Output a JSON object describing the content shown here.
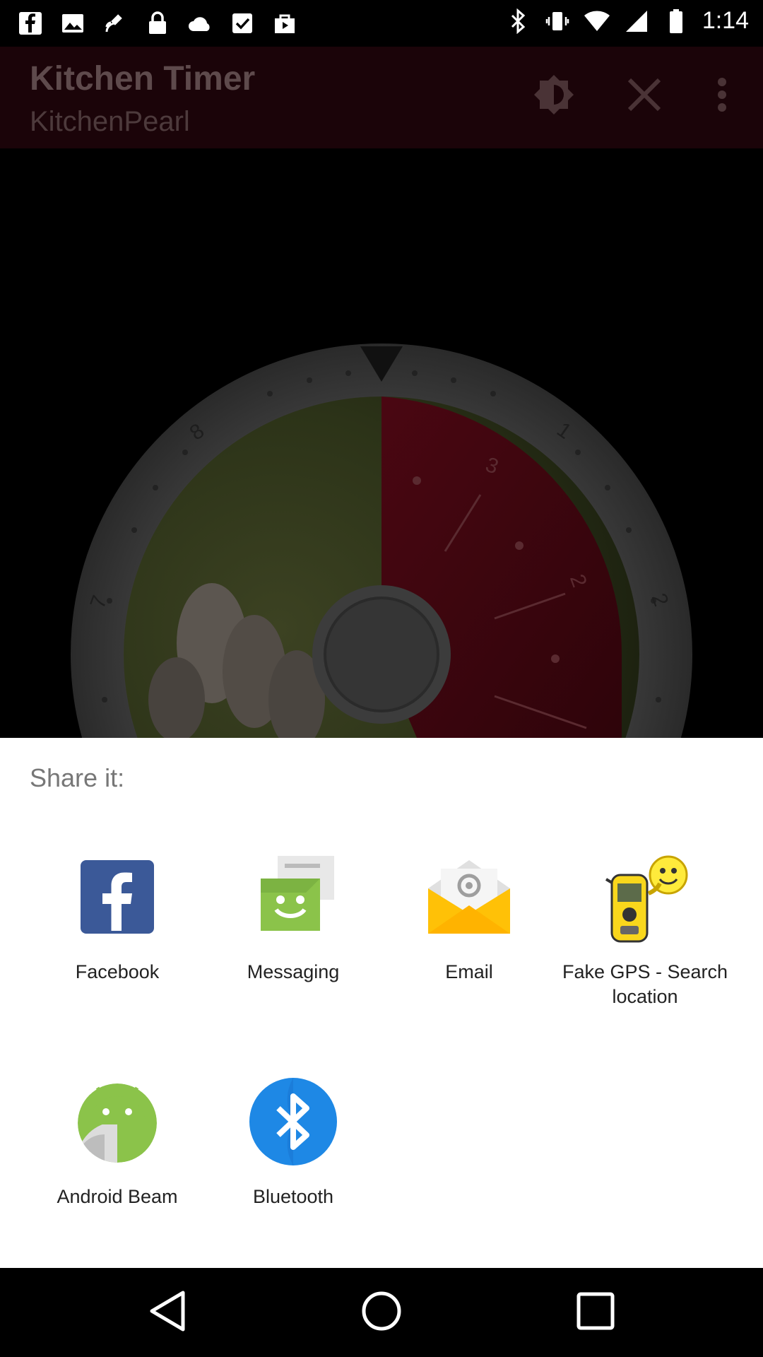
{
  "status_bar": {
    "time": "1:14",
    "left_icons": [
      "facebook-icon",
      "gallery-icon",
      "satellite-icon",
      "lock-icon",
      "cloud-icon",
      "check-box-icon",
      "shop-icon"
    ],
    "right_icons": [
      "bluetooth-icon",
      "vibrate-icon",
      "wifi-icon",
      "signal-icon",
      "battery-icon"
    ]
  },
  "app_header": {
    "title": "Kitchen Timer",
    "subtitle": "KitchenPearl",
    "actions": [
      "brightness-icon",
      "close-icon",
      "more-vert-icon"
    ]
  },
  "timer": {
    "outer_numbers": [
      "8",
      "7",
      "1",
      "2"
    ],
    "inner_numbers": [
      "3",
      "2"
    ]
  },
  "share_sheet": {
    "title": "Share it:",
    "apps": [
      {
        "label": "Facebook",
        "icon": "facebook-icon"
      },
      {
        "label": "Messaging",
        "icon": "messaging-icon"
      },
      {
        "label": "Email",
        "icon": "email-icon"
      },
      {
        "label": "Fake GPS - Search location",
        "icon": "fake-gps-icon"
      },
      {
        "label": "Android Beam",
        "icon": "android-beam-icon"
      },
      {
        "label": "Bluetooth",
        "icon": "bluetooth-icon"
      }
    ]
  },
  "nav_bar": {
    "buttons": [
      "back-icon",
      "home-icon",
      "recents-icon"
    ]
  }
}
